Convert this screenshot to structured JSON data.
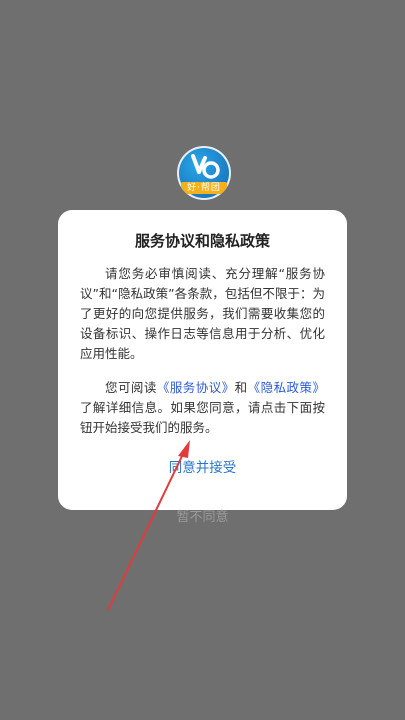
{
  "logo": {
    "ribbon_text": "好·帮团",
    "ribbon_color": "#f3b21b",
    "circle_color": "#1b7fc6"
  },
  "dialog": {
    "title": "服务协议和隐私政策",
    "para1": "请您务必审慎阅读、充分理解“服务协议”和“隐私政策”各条款，包括但不限于：为了更好的向您提供服务，我们需要收集您的设备标识、操作日志等信息用于分析、优化应用性能。",
    "para2_prefix": "您可阅读",
    "service_link": "《服务协议》",
    "para2_and": "和",
    "privacy_link": "《隐私政策》",
    "para2_suffix": "了解详细信息。如果您同意，请点击下面按钮开始接受我们的服务。",
    "agree_label": "同意并接受",
    "disagree_label": "暂不同意"
  },
  "colors": {
    "overlay": "#6f6f6f",
    "agree": "#2a74c9",
    "link": "#2d5bd6",
    "disagree": "#9a9a9a",
    "annotation_arrow": "#e23b3b"
  }
}
